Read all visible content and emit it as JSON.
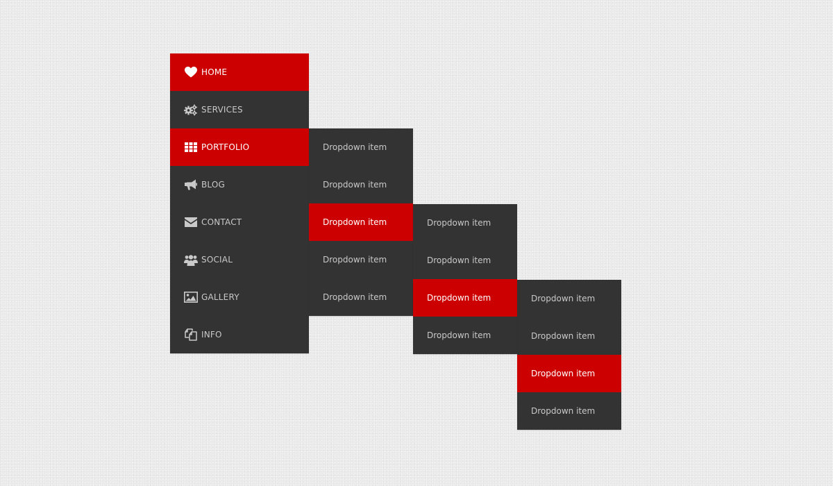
{
  "main_menu": {
    "items": [
      {
        "label": "HOME",
        "icon": "heart-icon",
        "active": true
      },
      {
        "label": "SERVICES",
        "icon": "gears-icon",
        "active": false
      },
      {
        "label": "PORTFOLIO",
        "icon": "grid-icon",
        "active": true
      },
      {
        "label": "BLOG",
        "icon": "megaphone-icon",
        "active": false
      },
      {
        "label": "CONTACT",
        "icon": "envelope-icon",
        "active": false
      },
      {
        "label": "SOCIAL",
        "icon": "group-icon",
        "active": false
      },
      {
        "label": "GALLERY",
        "icon": "picture-icon",
        "active": false
      },
      {
        "label": "INFO",
        "icon": "files-icon",
        "active": false
      }
    ]
  },
  "submenu_level_1": {
    "items": [
      {
        "label": "Dropdown item",
        "active": false
      },
      {
        "label": "Dropdown item",
        "active": false
      },
      {
        "label": "Dropdown item",
        "active": true
      },
      {
        "label": "Dropdown item",
        "active": false
      },
      {
        "label": "Dropdown item",
        "active": false
      }
    ]
  },
  "submenu_level_2": {
    "items": [
      {
        "label": "Dropdown item",
        "active": false
      },
      {
        "label": "Dropdown item",
        "active": false
      },
      {
        "label": "Dropdown item",
        "active": true
      },
      {
        "label": "Dropdown item",
        "active": false
      }
    ]
  },
  "submenu_level_3": {
    "items": [
      {
        "label": "Dropdown item",
        "active": false
      },
      {
        "label": "Dropdown item",
        "active": false
      },
      {
        "label": "Dropdown item",
        "active": true
      },
      {
        "label": "Dropdown item",
        "active": false
      }
    ]
  },
  "colors": {
    "accent": "#cc0000",
    "menu_background": "#333333",
    "text": "#c9c9c9",
    "page_background": "#ececec"
  }
}
